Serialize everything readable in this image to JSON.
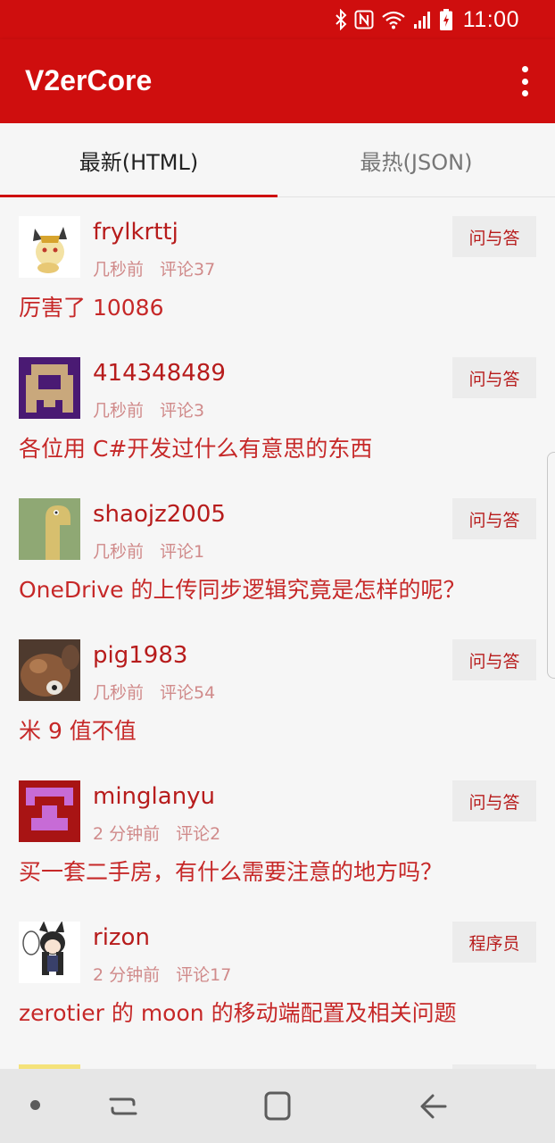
{
  "status_bar": {
    "time": "11:00",
    "icons": [
      "bluetooth-icon",
      "nfc-icon",
      "wifi-icon",
      "signal-icon",
      "battery-charging-icon"
    ]
  },
  "app_bar": {
    "title": "V2erCore",
    "menu_icon": "more-vert-icon"
  },
  "tabs": [
    {
      "label": "最新(HTML)",
      "selected": true
    },
    {
      "label": "最热(JSON)",
      "selected": false
    }
  ],
  "topics": [
    {
      "user": "frylkrttj",
      "time": "几秒前",
      "comments": "评论37",
      "node": "问与答",
      "title": "厉害了 10086"
    },
    {
      "user": "414348489",
      "time": "几秒前",
      "comments": "评论3",
      "node": "问与答",
      "title": "各位用 C#开发过什么有意思的东西"
    },
    {
      "user": "shaojz2005",
      "time": "几秒前",
      "comments": "评论1",
      "node": "问与答",
      "title": "OneDrive 的上传同步逻辑究竟是怎样的呢？"
    },
    {
      "user": "pig1983",
      "time": "几秒前",
      "comments": "评论54",
      "node": "问与答",
      "title": "米 9 值不值"
    },
    {
      "user": "minglanyu",
      "time": "2 分钟前",
      "comments": "评论2",
      "node": "问与答",
      "title": "买一套二手房，有什么需要注意的地方吗？"
    },
    {
      "user": "rizon",
      "time": "2 分钟前",
      "comments": "评论17",
      "node": "程序员",
      "title": "zerotier 的 moon 的移动端配置及相关问题"
    }
  ],
  "nav_bar": {
    "icons": [
      "nav-dot-icon",
      "recents-icon",
      "home-icon",
      "back-icon"
    ]
  },
  "colors": {
    "primary": "#cf0e0e",
    "accent_text": "#c62828",
    "meta_text": "#d08a8a",
    "background": "#f6f6f6"
  }
}
